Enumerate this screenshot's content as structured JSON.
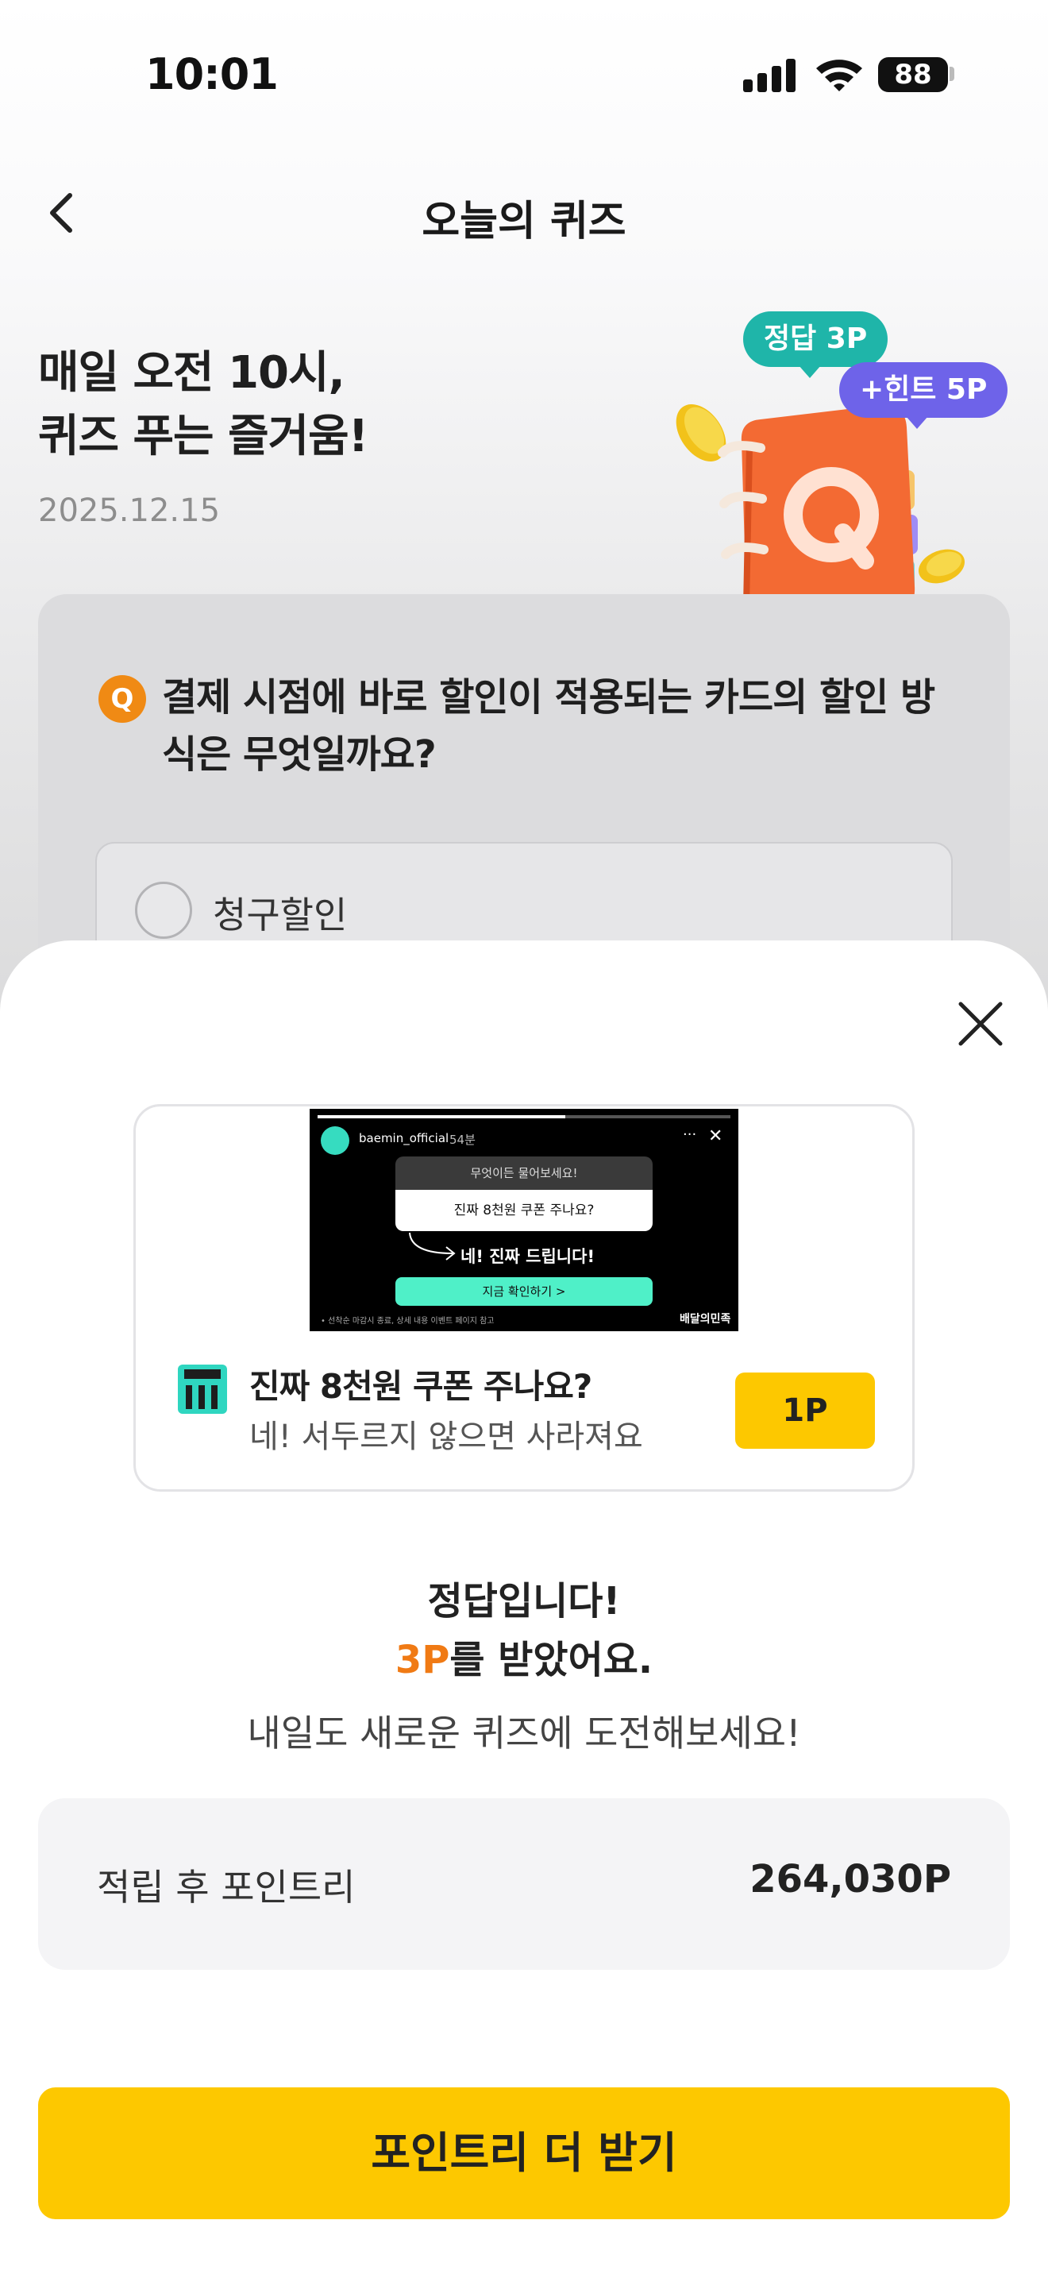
{
  "status_bar": {
    "time": "10:01",
    "battery": "88"
  },
  "header": {
    "title": "오늘의 퀴즈"
  },
  "hero": {
    "title_line1": "매일 오전 10시,",
    "title_line2": "퀴즈 푸는 즐거움!",
    "date": "2025.12.15",
    "badge_answer": "정답 3P",
    "badge_hint": "+힌트 5P",
    "icon_letter": "Q"
  },
  "question": {
    "badge": "Q",
    "text": "결제 시점에 바로 할인이 적용되는 카드의 할인 방식은 무엇일까요?",
    "options": [
      {
        "label": "청구할인"
      }
    ]
  },
  "ad": {
    "thumbnail": {
      "account": "baemin_official",
      "time": "54분",
      "question_head": "무엇이든 물어보세요!",
      "question_body": "진짜 8천원 쿠폰 주나요?",
      "answer": "네! 진짜 드립니다!",
      "cta": "지금 확인하기 >",
      "note": "• 선착순 마감시 종료, 상세 내용 이벤트 페이지 참고",
      "brand": "배달의민족"
    },
    "title": "진짜 8천원 쿠폰 주나요?",
    "subtitle": "네! 서두르지 않으면 사라져요",
    "point_label": "1P"
  },
  "result": {
    "line1": "정답입니다!",
    "line2_accent": "3P",
    "line2_rest": "를 받았어요.",
    "line3": "내일도 새로운 퀴즈에 도전해보세요!"
  },
  "points": {
    "label": "적립 후 포인트리",
    "value": "264,030P"
  },
  "cta_button": {
    "label": "포인트리 더 받기"
  },
  "colors": {
    "accent_yellow": "#fdc800",
    "accent_orange": "#f07a14",
    "teal": "#1fb5a9",
    "purple": "#6e63e9"
  }
}
